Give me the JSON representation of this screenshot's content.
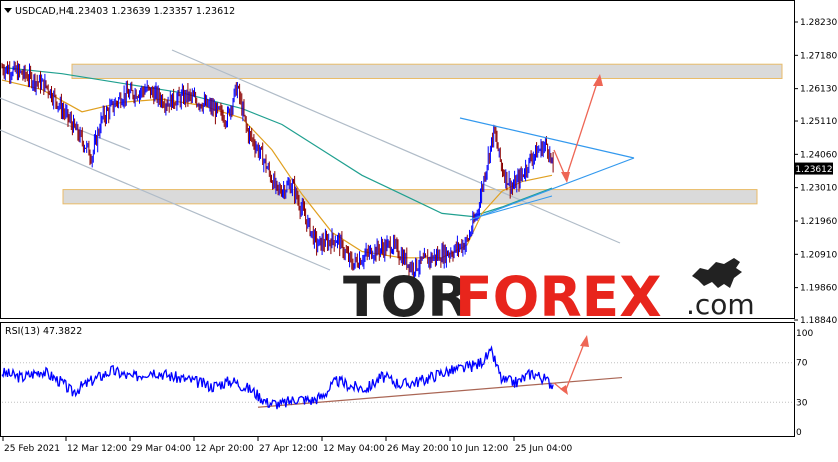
{
  "header": {
    "symbol": "USDCAD,H4",
    "ohlc": "1.23403 1.23639 1.23357 1.23612"
  },
  "rsi": {
    "label": "RSI(13) 47.3822",
    "levels": [
      "100",
      "70",
      "30",
      "0"
    ]
  },
  "watermark": {
    "tor": "TOR",
    "forex": "FOREX",
    "dotcom": ".com"
  },
  "colors": {
    "bull_candle": "#0000ff",
    "bear_candle": "#8b0000",
    "ma_fast": "#e0a020",
    "ma_slow": "#20a090",
    "channel": "#b0bcc8",
    "triangle": "#3399ee",
    "zone_fill": "#d9d9d9",
    "zone_border": "#e8b860",
    "arrow": "#ee6655",
    "rsi_line": "#0000ff",
    "rsi_trendline": "#aa6655",
    "current_price_bg": "#000000"
  },
  "chart_data": [
    {
      "type": "candlestick",
      "title": "USDCAD,H4",
      "y_ticks": [
        "1.28230",
        "1.27180",
        "1.26130",
        "1.25110",
        "1.24060",
        "1.23010",
        "1.21960",
        "1.20910",
        "1.19860",
        "1.18840"
      ],
      "ylim": [
        1.1884,
        1.2823
      ],
      "current_price": "1.23612",
      "x_ticks": [
        "25 Feb 2021",
        "12 Mar 12:00",
        "29 Mar 04:00",
        "12 Apr 20:00",
        "27 Apr 12:00",
        "12 May 04:00",
        "26 May 20:00",
        "10 Jun 12:00",
        "25 Jun 04:00"
      ],
      "price_path": [
        [
          0,
          1.268
        ],
        [
          20,
          1.266
        ],
        [
          45,
          1.262
        ],
        [
          70,
          1.25
        ],
        [
          90,
          1.24
        ],
        [
          100,
          1.252
        ],
        [
          120,
          1.259
        ],
        [
          145,
          1.261
        ],
        [
          165,
          1.257
        ],
        [
          185,
          1.259
        ],
        [
          205,
          1.256
        ],
        [
          225,
          1.252
        ],
        [
          235,
          1.262
        ],
        [
          245,
          1.248
        ],
        [
          260,
          1.24
        ],
        [
          275,
          1.229
        ],
        [
          290,
          1.231
        ],
        [
          300,
          1.223
        ],
        [
          315,
          1.212
        ],
        [
          335,
          1.214
        ],
        [
          350,
          1.206
        ],
        [
          370,
          1.21
        ],
        [
          390,
          1.212
        ],
        [
          410,
          1.205
        ],
        [
          430,
          1.208
        ],
        [
          450,
          1.21
        ],
        [
          465,
          1.213
        ],
        [
          475,
          1.222
        ],
        [
          485,
          1.238
        ],
        [
          492,
          1.248
        ],
        [
          500,
          1.236
        ],
        [
          510,
          1.23
        ],
        [
          520,
          1.234
        ],
        [
          530,
          1.24
        ],
        [
          545,
          1.244
        ],
        [
          552,
          1.234
        ]
      ],
      "ma_slow_path": [
        [
          0,
          1.268
        ],
        [
          60,
          1.266
        ],
        [
          120,
          1.263
        ],
        [
          180,
          1.26
        ],
        [
          240,
          1.255
        ],
        [
          280,
          1.25
        ],
        [
          320,
          1.242
        ],
        [
          360,
          1.234
        ],
        [
          400,
          1.228
        ],
        [
          440,
          1.222
        ],
        [
          470,
          1.221
        ],
        [
          500,
          1.224
        ],
        [
          550,
          1.23
        ]
      ],
      "ma_fast_path": [
        [
          0,
          1.264
        ],
        [
          40,
          1.261
        ],
        [
          80,
          1.254
        ],
        [
          120,
          1.257
        ],
        [
          160,
          1.258
        ],
        [
          200,
          1.256
        ],
        [
          240,
          1.252
        ],
        [
          270,
          1.242
        ],
        [
          300,
          1.228
        ],
        [
          330,
          1.216
        ],
        [
          360,
          1.21
        ],
        [
          400,
          1.208
        ],
        [
          440,
          1.208
        ],
        [
          465,
          1.212
        ],
        [
          480,
          1.222
        ],
        [
          500,
          1.229
        ],
        [
          520,
          1.232
        ],
        [
          550,
          1.234
        ]
      ],
      "resistance_zone": [
        1.2645,
        1.269
      ],
      "support_zone": [
        1.225,
        1.2295
      ]
    },
    {
      "type": "line",
      "title": "RSI(13) 47.3822",
      "ylim": [
        0,
        100
      ],
      "y_ticks": [
        "100",
        "70",
        "30",
        "0"
      ],
      "rsi_path": [
        [
          0,
          60
        ],
        [
          20,
          55
        ],
        [
          40,
          62
        ],
        [
          60,
          50
        ],
        [
          70,
          40
        ],
        [
          90,
          52
        ],
        [
          110,
          62
        ],
        [
          130,
          55
        ],
        [
          150,
          62
        ],
        [
          170,
          56
        ],
        [
          190,
          52
        ],
        [
          210,
          46
        ],
        [
          230,
          52
        ],
        [
          250,
          42
        ],
        [
          265,
          30
        ],
        [
          280,
          28
        ],
        [
          295,
          34
        ],
        [
          310,
          32
        ],
        [
          320,
          36
        ],
        [
          335,
          52
        ],
        [
          350,
          46
        ],
        [
          365,
          44
        ],
        [
          380,
          56
        ],
        [
          400,
          48
        ],
        [
          420,
          52
        ],
        [
          440,
          60
        ],
        [
          460,
          64
        ],
        [
          475,
          68
        ],
        [
          490,
          80
        ],
        [
          500,
          52
        ],
        [
          515,
          50
        ],
        [
          530,
          60
        ],
        [
          540,
          55
        ],
        [
          552,
          47
        ]
      ],
      "trendline": [
        [
          0,
          25
        ],
        [
          552,
          55
        ]
      ]
    }
  ]
}
